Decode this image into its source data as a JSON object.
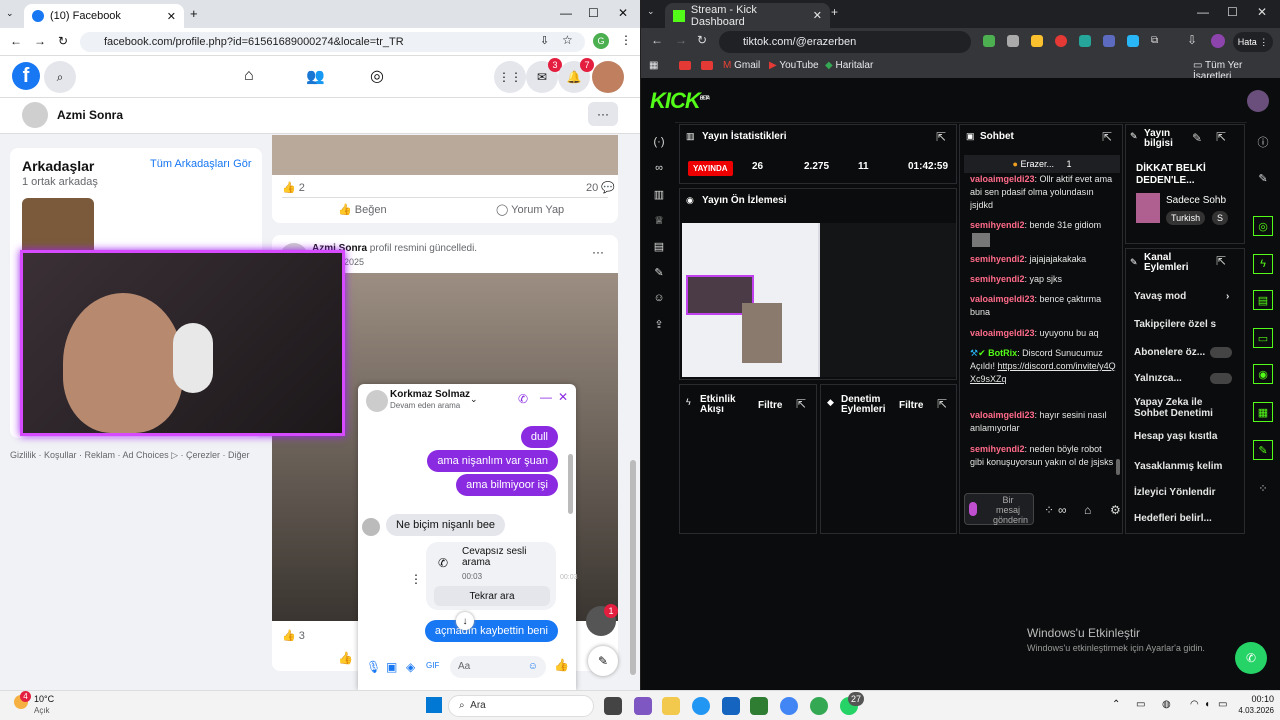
{
  "left_browser": {
    "tab_title": "(10) Facebook",
    "url": "facebook.com/profile.php?id=61561689000274&locale=tr_TR",
    "avatar_letter": "G"
  },
  "facebook": {
    "badges": {
      "messenger": "3",
      "notifications": "7"
    },
    "profile_name": "Azmi Sonra",
    "friends": {
      "title": "Arkadaşlar",
      "all_link": "Tüm Arkadaşları Gör",
      "mutual": "1 ortak arkadaş"
    },
    "footer_links": [
      "Gizlilik",
      "Koşullar",
      "Reklam",
      "Ad Choices",
      "Çerezler",
      "Diğer"
    ],
    "post1": {
      "likes": "2",
      "comments": "20",
      "like_label": "Beğen",
      "comment_label": "Yorum Yap"
    },
    "post2": {
      "author": "Azmi Sonra",
      "action": "profil resmini güncelledi.",
      "date": "2025",
      "likes": "3"
    },
    "chat_head_badge": "1"
  },
  "messenger": {
    "name": "Korkmaz Solmaz",
    "status": "Devam eden arama",
    "messages_out": [
      "dull",
      "ama nişanlım var şuan",
      "ama bilmiyoor işi"
    ],
    "message_in": "Ne biçim nişanlı bee",
    "missed_call": {
      "title": "Cevapsız sesli arama",
      "time": "00:03",
      "retry": "Tekrar ara",
      "side_time": "00:03"
    },
    "last_out": "açmadın kaybettin beni",
    "input_placeholder": "Aa"
  },
  "right_browser": {
    "tab_title": "Stream - Kick Dashboard",
    "url": "tiktok.com/@erazerben",
    "error_button": "Hata",
    "bookmarks": [
      "Gmail",
      "YouTube",
      "Haritalar"
    ],
    "bookmarks_all": "Tüm Yer İşaretleri"
  },
  "kick": {
    "logo": "KICK",
    "logo_beta": "BETA",
    "stats": {
      "title": "Yayın İstatistikleri",
      "live": "YAYINDA",
      "followers": "26",
      "views": "2.275",
      "viewers": "11",
      "time": "01:42:59"
    },
    "preview_title": "Yayın Ön İzlemesi",
    "activity": {
      "title": "Etkinlik Akışı",
      "filter": "Filtre"
    },
    "moderation": {
      "title": "Denetim Eylemleri",
      "filter": "Filtre"
    },
    "chat": {
      "title": "Sohbet",
      "pinned_user": "Erazer...",
      "pinned_count": "1",
      "input_placeholder": "Bir mesaj gönderin",
      "messages": [
        {
          "user": "valoaimgeldi23",
          "text": "Ollr aktif evet ama abi sen pdasif olma yolundasın jsjdkd",
          "color": "#ff6b8a"
        },
        {
          "user": "semihyendi2",
          "text": "bende 31e gidiom",
          "color": "#ff6b8a"
        },
        {
          "user": "semihyendi2",
          "text": "jajajajakakaka",
          "color": "#ff6b8a"
        },
        {
          "user": "semihyendi2",
          "text": "yap sjks",
          "color": "#ff6b8a"
        },
        {
          "user": "valoaimgeldi23",
          "text": "bence çaktırma buna",
          "color": "#ff6b8a"
        },
        {
          "user": "valoaimgeldi23",
          "text": "uyuyonu bu aq",
          "color": "#ff6b8a"
        },
        {
          "user": "BotRix",
          "text": "Discord Sunucumuz Açıldı!",
          "link": "https://discord.com/invite/y4QXc9sXZq",
          "color": "#53fc18"
        },
        {
          "user": "valoaimgeldi23",
          "text": "hayır sesini nasıl anlamıyorlar",
          "color": "#ff6b8a"
        },
        {
          "user": "semihyendi2",
          "text": "neden böyle robot gibi konuşuyorsun yakın ol de jsjsks",
          "color": "#ff6b8a"
        }
      ]
    },
    "stream_info": {
      "title": "Yayın bilgisi",
      "stream_title": "DİKKAT BELKİ DEDEN'LE...",
      "category": "Sadece Sohb",
      "tag1": "Turkish",
      "tag2": "S"
    },
    "channel_actions": {
      "title": "Kanal Eylemleri",
      "items": [
        "Yavaş mod",
        "Takipçilere özel s",
        "Abonelere öz...",
        "Yalnızca...",
        "Yapay Zeka ile Sohbet Denetimi",
        "Hesap yaşı kısıtla",
        "Yasaklanmış kelim",
        "İzleyici Yönlendir",
        "Hedefleri belirl..."
      ]
    }
  },
  "windows": {
    "watermark_title": "Windows'u Etkinleştir",
    "watermark_sub": "Windows'u etkinleştirmek için Ayarlar'a gidin."
  },
  "taskbar": {
    "weather_temp": "10°C",
    "weather_desc": "Açık",
    "weather_badge": "4",
    "search": "Ara",
    "clock_time": "00:10",
    "clock_date": "4.03.2026",
    "whatsapp_badge": "27"
  }
}
